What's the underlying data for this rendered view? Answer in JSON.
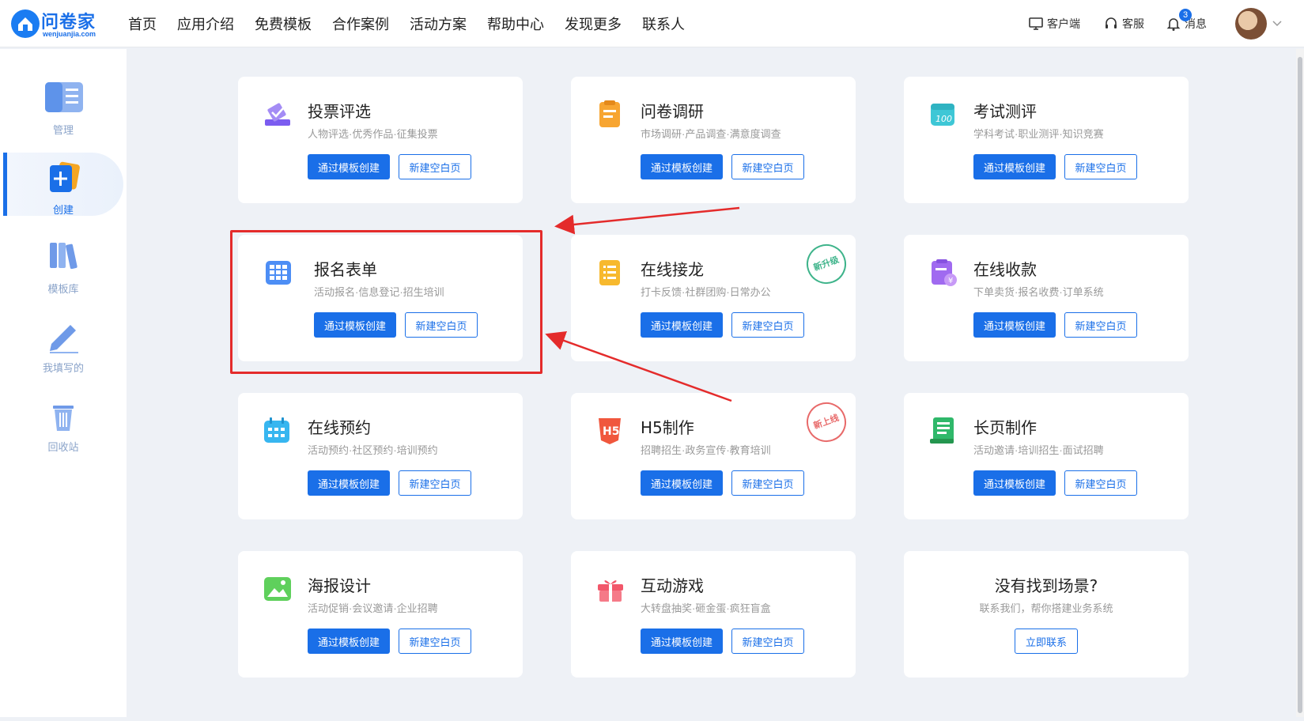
{
  "brand": {
    "name": "问卷家",
    "domain": "wenjuanjia.com",
    "accent": "#1a6fe8"
  },
  "nav": [
    "首页",
    "应用介绍",
    "免费模板",
    "合作案例",
    "活动方案",
    "帮助中心",
    "发现更多",
    "联系人"
  ],
  "header_right": {
    "client": "客户端",
    "service": "客服",
    "messages": "消息",
    "message_count": "3"
  },
  "sidebar": {
    "items": [
      {
        "label": "管理",
        "icon": "manage-icon"
      },
      {
        "label": "创建",
        "icon": "create-plus-icon",
        "active": true
      },
      {
        "label": "模板库",
        "icon": "template-library-icon"
      },
      {
        "label": "我填写的",
        "icon": "pen-icon"
      },
      {
        "label": "回收站",
        "icon": "trash-icon"
      }
    ]
  },
  "buttons": {
    "template": "通过模板创建",
    "blank": "新建空白页"
  },
  "cards": [
    {
      "title": "投票评选",
      "desc": "人物评选·优秀作品·征集投票",
      "icon": "vote-icon"
    },
    {
      "title": "问卷调研",
      "desc": "市场调研·产品调查·满意度调查",
      "icon": "survey-icon"
    },
    {
      "title": "考试测评",
      "desc": "学科考试·职业测评·知识竞赛",
      "icon": "exam-icon"
    },
    {
      "title": "报名表单",
      "desc": "活动报名·信息登记·招生培训",
      "icon": "form-grid-icon"
    },
    {
      "title": "在线接龙",
      "desc": "打卡反馈·社群团购·日常办公",
      "icon": "list-icon",
      "stamp": "新升级"
    },
    {
      "title": "在线收款",
      "desc": "下单卖货·报名收费·订单系统",
      "icon": "payment-icon"
    },
    {
      "title": "在线预约",
      "desc": "活动预约·社区预约·培训预约",
      "icon": "calendar-icon"
    },
    {
      "title": "H5制作",
      "desc": "招聘招生·政务宣传·教育培训",
      "icon": "h5-icon",
      "stamp": "新上线"
    },
    {
      "title": "长页制作",
      "desc": "活动邀请·培训招生·面试招聘",
      "icon": "long-page-icon"
    },
    {
      "title": "海报设计",
      "desc": "活动促销·会议邀请·企业招聘",
      "icon": "poster-icon"
    },
    {
      "title": "互动游戏",
      "desc": "大转盘抽奖·砸金蛋·疯狂盲盒",
      "icon": "gift-icon"
    }
  ],
  "not_found": {
    "title": "没有找到场景?",
    "desc": "联系我们，帮你搭建业务系统",
    "button": "立即联系"
  }
}
